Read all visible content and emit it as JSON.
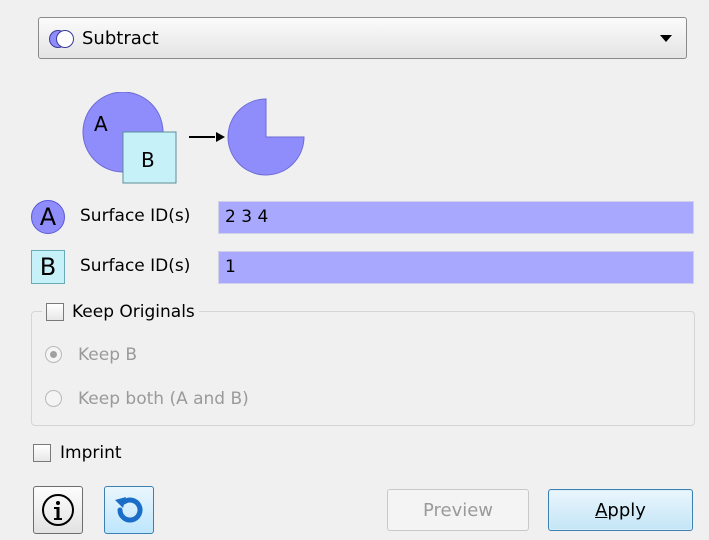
{
  "operation": {
    "selected": "Subtract",
    "icon": "subtract-venn-icon"
  },
  "diagram": {
    "label_a": "A",
    "label_b": "B",
    "arrow_icon": "arrow-right-icon"
  },
  "surface_a": {
    "badge": "A",
    "label": "Surface ID(s)",
    "value": "2 3 4"
  },
  "surface_b": {
    "badge": "B",
    "label": "Surface ID(s)",
    "value": "1"
  },
  "keep_originals": {
    "label": "Keep Originals",
    "checked": false,
    "options": [
      {
        "label": "Keep B",
        "selected": true
      },
      {
        "label": "Keep both (A and B)",
        "selected": false
      }
    ]
  },
  "imprint": {
    "label": "Imprint",
    "checked": false
  },
  "buttons": {
    "info_icon": "info-icon",
    "reset_icon": "reset-icon",
    "preview": "Preview",
    "apply_mnemonic": "A",
    "apply_rest": "pply"
  },
  "colors": {
    "field_fill": "#a8a8ff",
    "a_shape": "#8f8dfb",
    "b_shape": "#c7f1f8"
  }
}
